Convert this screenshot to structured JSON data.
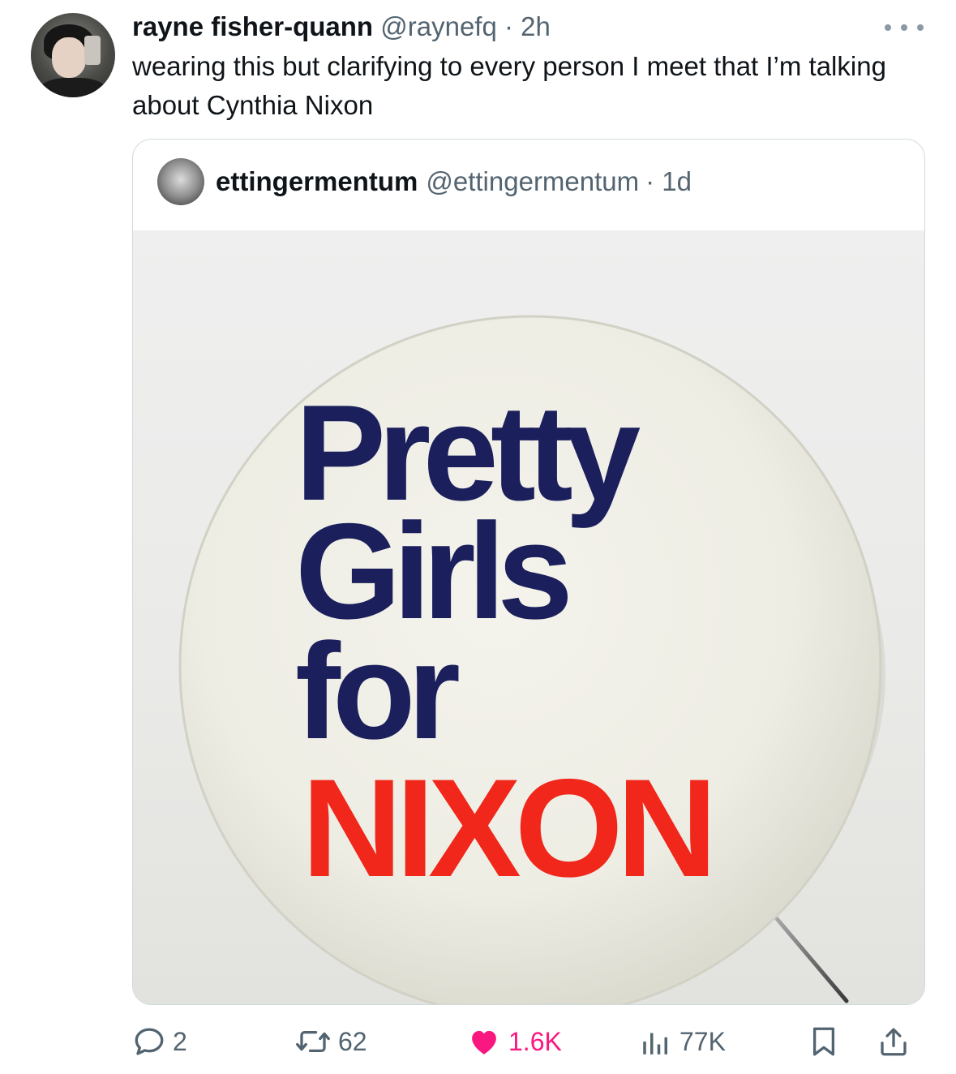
{
  "tweet": {
    "author_name": "rayne fisher-quann",
    "author_handle": "@raynefq",
    "time": "· 2h",
    "text": "wearing this but clarifying to every person I meet that I’m talking about Cynthia Nixon"
  },
  "quote": {
    "author_name": "ettingermentum",
    "author_handle": "@ettingermentum",
    "time": "· 1d",
    "image": {
      "button_text": {
        "line1": "Pretty",
        "line2": "Girls",
        "line3": "for",
        "line4": "NIXON"
      }
    }
  },
  "actions": {
    "replies": "2",
    "reposts": "62",
    "likes": "1.6K",
    "views": "77K"
  },
  "colors": {
    "navy": "#1b1f5c",
    "red": "#f0271a",
    "like_pink": "#f91880",
    "muted": "#536471"
  }
}
